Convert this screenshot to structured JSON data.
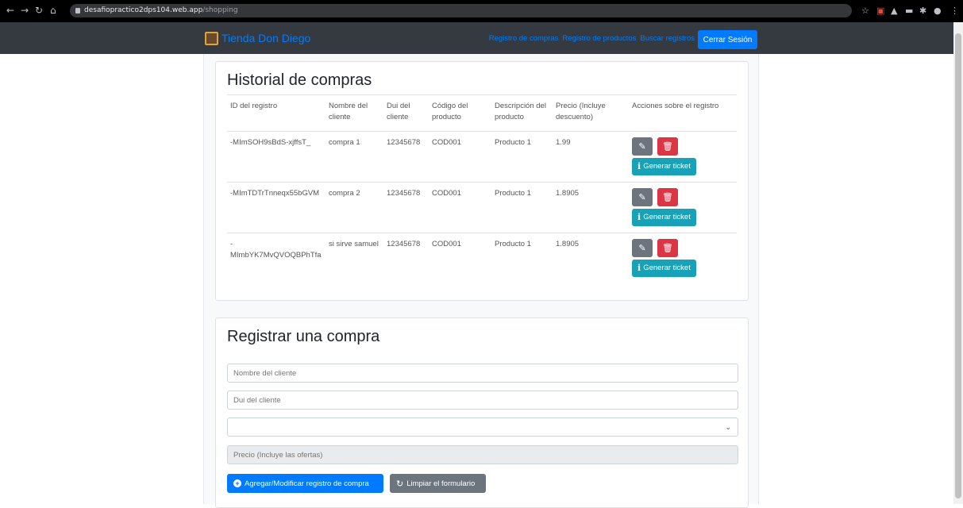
{
  "browser": {
    "url_domain": "desafiopractico2dps104.web.app",
    "url_path": "/shopping"
  },
  "navbar": {
    "brand": "Tienda Don Diego",
    "links": [
      "Registro de compras",
      "Registro de productos",
      "Buscar registros"
    ],
    "logout": "Cerrar Sesión"
  },
  "history": {
    "title": "Historial de compras",
    "columns": [
      "ID del registro",
      "Nombre del cliente",
      "Dui del cliente",
      "Código del producto",
      "Descripción del producto",
      "Precio (Incluye descuento)",
      "Acciones sobre el registro"
    ],
    "rows": [
      {
        "id": "-MImSOH9sBdS-xjffsT_",
        "name": "compra 1",
        "dui": "12345678",
        "code": "COD001",
        "desc": "Producto 1",
        "price": "1.99"
      },
      {
        "id": "-MImTDTrTnneqx55bGVM",
        "name": "compra 2",
        "dui": "12345678",
        "code": "COD001",
        "desc": "Producto 1",
        "price": "1.8905"
      },
      {
        "id": "-\nMImbYK7MvQVOQBPhTfa",
        "name": "si sirve samuel",
        "dui": "12345678",
        "code": "COD001",
        "desc": "Producto 1",
        "price": "1.8905"
      }
    ],
    "ticket_label": "Generar ticket"
  },
  "register": {
    "title": "Registrar una compra",
    "client_name_placeholder": "Nombre del cliente",
    "client_dui_placeholder": "Dui del cliente",
    "product_select_value": "",
    "price_placeholder": "Precio (Incluye las ofertas)",
    "submit_label": "Agregar/Modificar registro de compra",
    "reset_label": "Limpiar el formulario"
  }
}
